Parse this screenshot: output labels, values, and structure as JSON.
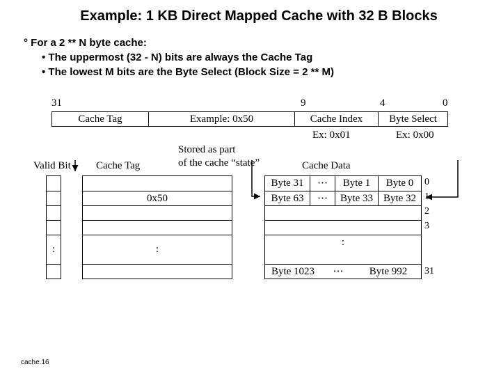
{
  "title": "Example: 1 KB Direct Mapped Cache with 32 B Blocks",
  "bullets": {
    "top": "° For a 2 ** N byte cache:",
    "b1": "• The uppermost (32 - N) bits are always the Cache Tag",
    "b2": "• The lowest M bits are the Byte Select (Block Size = 2 ** M)"
  },
  "addr_nums": {
    "n31": "31",
    "n9": "9",
    "n4": "4",
    "n0": "0"
  },
  "addr_fields": {
    "tag_lbl": "Cache Tag",
    "tag_ex": "Example: 0x50",
    "idx_lbl": "Cache Index",
    "sel_lbl": "Byte Select"
  },
  "examples": {
    "idx": "Ex: 0x01",
    "sel": "Ex: 0x00"
  },
  "stored": {
    "l1": "Stored as part",
    "l2": "of the cache “state”"
  },
  "table_labels": {
    "valid": "Valid Bit",
    "tag": "Cache Tag",
    "data": "Cache Data"
  },
  "tag_vals": {
    "r1": "0x50"
  },
  "data_rows": {
    "r0": {
      "c0": "Byte 31",
      "c1": "Byte 1",
      "c2": "Byte 0"
    },
    "r1": {
      "c0": "Byte 63",
      "c1": "Byte 33",
      "c2": "Byte 32"
    },
    "rlast": {
      "c0": "Byte 1023",
      "c2": "Byte 992"
    }
  },
  "dots": "⋯",
  "vdots": ":",
  "rownums": {
    "r0": "0",
    "r1": "1",
    "r2": "2",
    "r3": "3",
    "rlast": "31"
  },
  "footer": "cache.16"
}
